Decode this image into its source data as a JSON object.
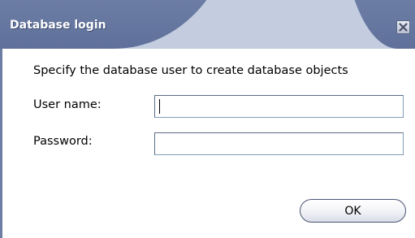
{
  "window": {
    "title": "Database login",
    "close_icon": "close-icon",
    "colors": {
      "title_bar_dark": "#7384ab",
      "title_bar_light": "#c3cddf",
      "title_text": "#ffffff"
    }
  },
  "dialog": {
    "prompt": "Specify the database user to create database objects",
    "user_name_label": "User name:",
    "user_name_value": "",
    "password_label": "Password:",
    "password_value": "",
    "ok_label": "OK"
  }
}
